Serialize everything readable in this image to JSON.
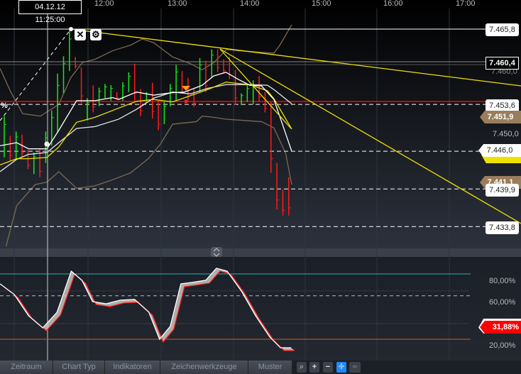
{
  "header": {
    "crosshair_datetime": "04.12.12 11:25:00",
    "time_labels": [
      "12:00",
      "13:00",
      "14:00",
      "15:00",
      "16:00",
      "17:00"
    ]
  },
  "price_labels": {
    "l1": "7.465,8",
    "current": "7.460,4",
    "ghost": "7.460,0",
    "l2": "7.453,6",
    "bb_upper": "7.451,9",
    "axis": "7.450,0",
    "ma": "7.446,0",
    "bb_lower": "7.441,1",
    "l3": "7.439,9",
    "l4": "7.433,8"
  },
  "left_label": "%",
  "oscillator": {
    "labels": [
      "80,00%",
      "60,00%",
      "20,00%"
    ],
    "current": "31,88%"
  },
  "toolbar": {
    "tabs": [
      "Zeitraum",
      "Chart Typ",
      "Indikatoren",
      "Zeichenwerkzeuge",
      "Muster"
    ],
    "icons": [
      "search-icon",
      "zoom-in-icon",
      "zoom-out-icon",
      "crosshair-icon",
      "ruler-icon"
    ]
  },
  "colors": {
    "up": "#19e619",
    "down": "#ff1a1a",
    "yellow": "#f0e000",
    "band": "#7a6a55",
    "accent_red": "#ff0000"
  },
  "chart_data": {
    "type": "ohlc",
    "price_axis": [
      7.4336,
      7.4658
    ],
    "candles": [
      [
        7.4517,
        7.445,
        1
      ],
      [
        7.4485,
        7.4445,
        -1
      ],
      [
        7.4492,
        7.4448,
        1
      ],
      [
        7.4487,
        7.445,
        -1
      ],
      [
        7.4462,
        7.4431,
        -1
      ],
      [
        7.4458,
        7.4423,
        1
      ],
      [
        7.4464,
        7.4418,
        -1
      ],
      [
        7.4492,
        7.4441,
        1
      ],
      [
        7.4526,
        7.4469,
        1
      ],
      [
        7.4586,
        7.449,
        1
      ],
      [
        7.4614,
        7.4554,
        1
      ],
      [
        7.4655,
        7.459,
        1
      ],
      [
        7.4613,
        7.4594,
        -1
      ],
      [
        7.4596,
        7.4538,
        -1
      ],
      [
        7.4546,
        7.451,
        1
      ],
      [
        7.4567,
        7.4523,
        -1
      ],
      [
        7.4563,
        7.4533,
        1
      ],
      [
        7.4569,
        7.4546,
        1
      ],
      [
        7.4567,
        7.4542,
        1
      ],
      [
        7.4556,
        7.4544,
        -1
      ],
      [
        7.4572,
        7.4542,
        1
      ],
      [
        7.4588,
        7.4556,
        1
      ],
      [
        7.4602,
        7.4542,
        -1
      ],
      [
        7.4561,
        7.4517,
        -1
      ],
      [
        7.4556,
        7.454,
        1
      ],
      [
        7.4571,
        7.4513,
        -1
      ],
      [
        7.4544,
        7.4494,
        -1
      ],
      [
        7.454,
        7.4504,
        1
      ],
      [
        7.4569,
        7.4533,
        1
      ],
      [
        7.46,
        7.4542,
        1
      ],
      [
        7.459,
        7.4556,
        -1
      ],
      [
        7.4579,
        7.4542,
        -1
      ],
      [
        7.4561,
        7.4532,
        -1
      ],
      [
        7.4611,
        7.4556,
        1
      ],
      [
        7.4607,
        7.4556,
        -1
      ],
      [
        7.4625,
        7.458,
        1
      ],
      [
        7.4625,
        7.4588,
        -1
      ],
      [
        7.4609,
        7.4586,
        -1
      ],
      [
        7.4613,
        7.4577,
        -1
      ],
      [
        7.4592,
        7.4535,
        -1
      ],
      [
        7.4554,
        7.4535,
        1
      ],
      [
        7.4567,
        7.454,
        1
      ],
      [
        7.4575,
        7.4536,
        1
      ],
      [
        7.4582,
        7.454,
        -1
      ],
      [
        7.4556,
        7.4523,
        -1
      ],
      [
        7.454,
        7.4425,
        -1
      ],
      [
        7.4441,
        7.4366,
        -1
      ],
      [
        7.4398,
        7.4356,
        -1
      ],
      [
        7.4418,
        7.4356,
        -1
      ]
    ],
    "ma_white_1": [
      [
        -0.7,
        7.4469
      ],
      [
        2.1,
        7.4474
      ],
      [
        4.1,
        7.4464
      ],
      [
        7.2,
        7.4464
      ],
      [
        9.2,
        7.4494
      ],
      [
        12.2,
        7.4542
      ],
      [
        15.3,
        7.4542
      ],
      [
        18.3,
        7.4547
      ],
      [
        19.3,
        7.4544
      ],
      [
        22.3,
        7.4556
      ],
      [
        25.2,
        7.4551
      ],
      [
        28.4,
        7.4555
      ],
      [
        30.4,
        7.4556
      ],
      [
        33.4,
        7.4567
      ],
      [
        35.3,
        7.4582
      ],
      [
        37.4,
        7.4588
      ],
      [
        39.4,
        7.4577
      ],
      [
        41.4,
        7.4567
      ],
      [
        43.4,
        7.4566
      ],
      [
        45.5,
        7.4544
      ],
      [
        48.5,
        7.446
      ]
    ],
    "ma_yellow": [
      [
        -0.7,
        7.4438
      ],
      [
        2.1,
        7.4448
      ],
      [
        4.1,
        7.4448
      ],
      [
        7.2,
        7.445
      ],
      [
        9.2,
        7.4467
      ],
      [
        12.2,
        7.4507
      ],
      [
        15.3,
        7.4515
      ],
      [
        19.3,
        7.453
      ],
      [
        22.3,
        7.4541
      ],
      [
        25.2,
        7.4544
      ],
      [
        28.4,
        7.454
      ],
      [
        31.4,
        7.455
      ],
      [
        34.3,
        7.456
      ],
      [
        37.4,
        7.4572
      ],
      [
        41.4,
        7.4568
      ],
      [
        44.4,
        7.4558
      ],
      [
        45.5,
        7.4545
      ],
      [
        48.5,
        7.4496
      ]
    ],
    "ma_white_2": [
      [
        -0.7,
        7.4427
      ],
      [
        2.1,
        7.4447
      ],
      [
        4.1,
        7.4455
      ],
      [
        7.2,
        7.4458
      ],
      [
        9.2,
        7.4474
      ],
      [
        12.2,
        7.4497
      ],
      [
        15.3,
        7.45
      ],
      [
        19.3,
        7.4512
      ],
      [
        22.3,
        7.4528
      ],
      [
        25.2,
        7.4546
      ],
      [
        28.4,
        7.4556
      ],
      [
        31.4,
        7.4553
      ],
      [
        34.3,
        7.4562
      ],
      [
        37.4,
        7.4568
      ],
      [
        41.4,
        7.4568
      ],
      [
        44.4,
        7.4567
      ],
      [
        45.5,
        7.456
      ],
      [
        48.5,
        7.4537
      ]
    ],
    "bb_upper": [
      [
        -0.7,
        7.4594
      ],
      [
        1.1,
        7.4556
      ],
      [
        3.1,
        7.4521
      ],
      [
        6.1,
        7.4517
      ],
      [
        9.2,
        7.4536
      ],
      [
        11.2,
        7.4579
      ],
      [
        13.2,
        7.4604
      ],
      [
        15.3,
        7.4609
      ],
      [
        18.3,
        7.4623
      ],
      [
        21.3,
        7.4632
      ],
      [
        23.3,
        7.4642
      ],
      [
        25.2,
        7.4636
      ],
      [
        28.4,
        7.4613
      ],
      [
        31.4,
        7.4602
      ],
      [
        33.4,
        7.4592
      ],
      [
        35.4,
        7.4604
      ],
      [
        37.5,
        7.4625
      ],
      [
        39.5,
        7.4623
      ],
      [
        42.5,
        7.4621
      ],
      [
        45.5,
        7.4619
      ],
      [
        46.5,
        7.4632
      ],
      [
        48.5,
        7.4665
      ]
    ],
    "bb_lower": [
      [
        0.3,
        7.4306
      ],
      [
        2.1,
        7.4372
      ],
      [
        5.2,
        7.4406
      ],
      [
        7.2,
        7.441
      ],
      [
        9.2,
        7.4427
      ],
      [
        12.2,
        7.44
      ],
      [
        15.3,
        7.4404
      ],
      [
        18.3,
        7.4414
      ],
      [
        21.3,
        7.4425
      ],
      [
        24.3,
        7.4448
      ],
      [
        26.3,
        7.4471
      ],
      [
        28.4,
        7.4504
      ],
      [
        30.4,
        7.4506
      ],
      [
        32.4,
        7.4508
      ],
      [
        33.4,
        7.4517
      ],
      [
        35.4,
        7.4515
      ],
      [
        37.4,
        7.4512
      ],
      [
        40.4,
        7.451
      ],
      [
        43.4,
        7.4508
      ],
      [
        45.5,
        7.4498
      ],
      [
        47.5,
        7.4456
      ],
      [
        48.5,
        7.4406
      ]
    ],
    "stochastic_k": [
      [
        -0.7,
        70.9
      ],
      [
        1.7,
        61.1
      ],
      [
        4.1,
        41.6
      ],
      [
        6.5,
        30.5
      ],
      [
        8.9,
        44.8
      ],
      [
        11.3,
        82.6
      ],
      [
        13.1,
        74.2
      ],
      [
        14.9,
        54.6
      ],
      [
        17.2,
        52.6
      ],
      [
        19.6,
        56
      ],
      [
        22,
        56.6
      ],
      [
        24.4,
        44.8
      ],
      [
        26.2,
        20
      ],
      [
        28,
        31.8
      ],
      [
        29.8,
        70.9
      ],
      [
        31.6,
        72.2
      ],
      [
        34,
        74.2
      ],
      [
        35.8,
        85.3
      ],
      [
        37.6,
        82.6
      ],
      [
        40,
        64.4
      ],
      [
        42.4,
        41.6
      ],
      [
        44.8,
        22.1
      ],
      [
        46.6,
        12.2
      ],
      [
        48.4,
        12.2
      ]
    ],
    "osc_levels": [
      80,
      60,
      20
    ],
    "price_levels": [
      7.4658,
      7.4536,
      7.446,
      7.4399,
      7.4338
    ]
  }
}
